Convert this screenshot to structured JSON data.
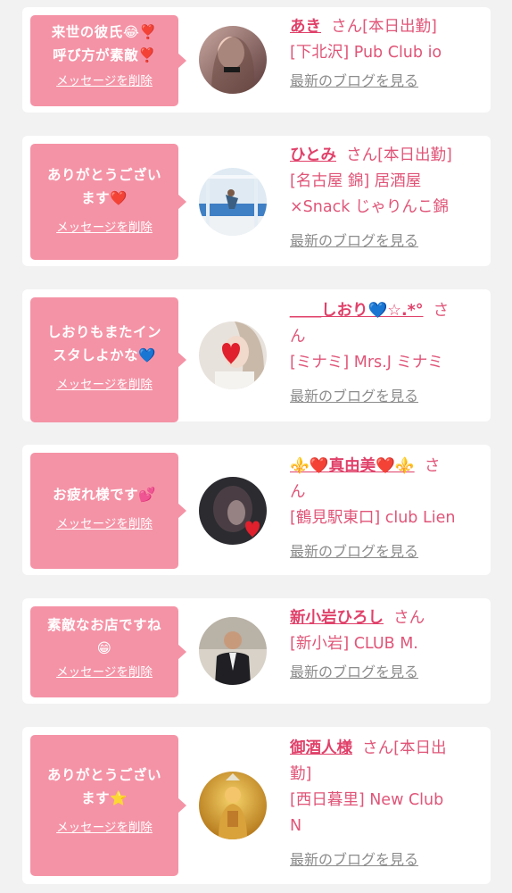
{
  "messages": [
    {
      "bubble_text": "来世の彼氏😂❣️\n呼び方が素敵❣️",
      "delete_label": "メッセージを削除",
      "name": "あき",
      "honorific": "さん[本日出勤]",
      "shop": "[下北沢] Pub Club io",
      "blog_label": "最新のブログを見る",
      "avatar_icon": "avatar-photo-woman"
    },
    {
      "bubble_text": "ありがとうござい\nます❤️",
      "delete_label": "メッセージを削除",
      "name": "ひとみ",
      "honorific": "さん[本日出勤]",
      "shop": "[名古屋 錦] 居酒屋\n×Snack じゃりんこ錦",
      "blog_label": "最新のブログを見る",
      "avatar_icon": "avatar-photo-beach"
    },
    {
      "bubble_text": "しおりもまたイン\nスタしよかな💙",
      "delete_label": "メッセージを削除",
      "name": "＿＿しおり💙☆.*°",
      "honorific": "さ\nん",
      "shop": "[ミナミ] Mrs.J ミナミ",
      "blog_label": "最新のブログを見る",
      "avatar_icon": "avatar-photo-heart"
    },
    {
      "bubble_text": "お疲れ様です💕",
      "delete_label": "メッセージを削除",
      "name": "⚜️❤️真由美❤️⚜️",
      "honorific": "さ\nん",
      "shop": "[鶴見駅東口] club Lien",
      "blog_label": "最新のブログを見る",
      "avatar_icon": "avatar-photo-dark"
    },
    {
      "bubble_text": "素敵なお店ですね\n😁",
      "delete_label": "メッセージを削除",
      "name": "新小岩ひろし",
      "honorific": "さん",
      "shop": "[新小岩] CLUB M.",
      "blog_label": "最新のブログを見る",
      "avatar_icon": "avatar-photo-man"
    },
    {
      "bubble_text": "ありがとうござい\nます⭐",
      "delete_label": "メッセージを削除",
      "name": "御酒人様",
      "honorific": "さん[本日出\n勤]",
      "shop": "[西日暮里] New Club\nN",
      "blog_label": "最新のブログを見る",
      "avatar_icon": "avatar-photo-gold"
    }
  ],
  "colors": {
    "bubble_bg": "#f593a6",
    "name_text": "#e0416a",
    "info_text": "#e05578",
    "blog_link": "#8c8c8c",
    "page_bg": "#f2f2f3"
  }
}
